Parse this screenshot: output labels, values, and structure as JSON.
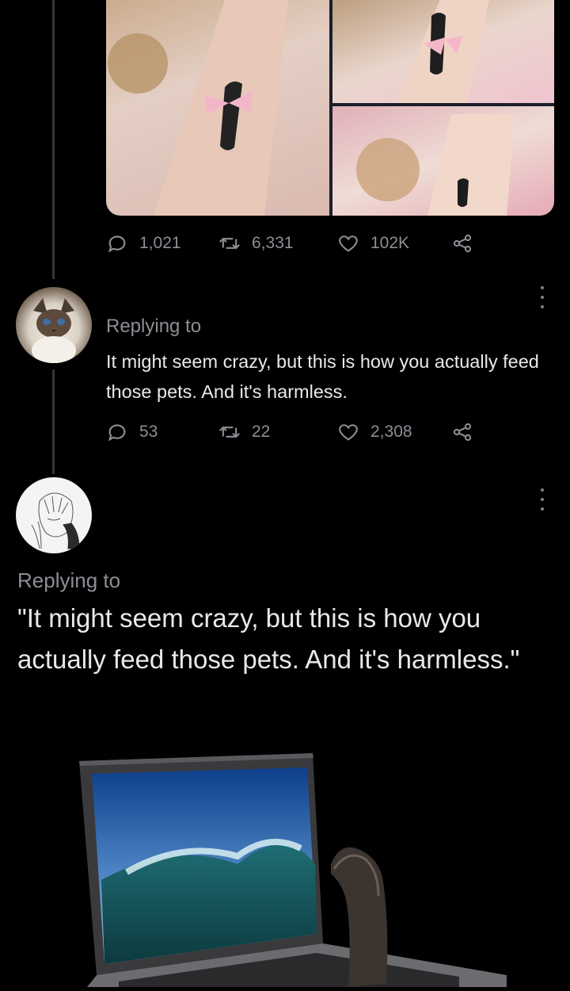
{
  "tweet1": {
    "stats": {
      "replies": "1,021",
      "retweets": "6,331",
      "likes": "102K"
    }
  },
  "reply1": {
    "replying_to": "Replying to",
    "text": "It might seem crazy, but this is how you actually feed those pets. And it's harmless.",
    "stats": {
      "replies": "53",
      "retweets": "22",
      "likes": "2,308"
    }
  },
  "reply2": {
    "replying_to": "Replying to",
    "text": "\"It might seem crazy, but this is how you actually feed those pets. And it's harmless.\""
  },
  "icons": {
    "reply": "speech-bubble-icon",
    "retweet": "retweet-icon",
    "like": "heart-icon",
    "share": "share-icon",
    "more": "more-options-icon"
  },
  "colors": {
    "background": "#000000",
    "text": "#e7e9ea",
    "muted": "#8b8f95",
    "thread_line": "#333639"
  }
}
